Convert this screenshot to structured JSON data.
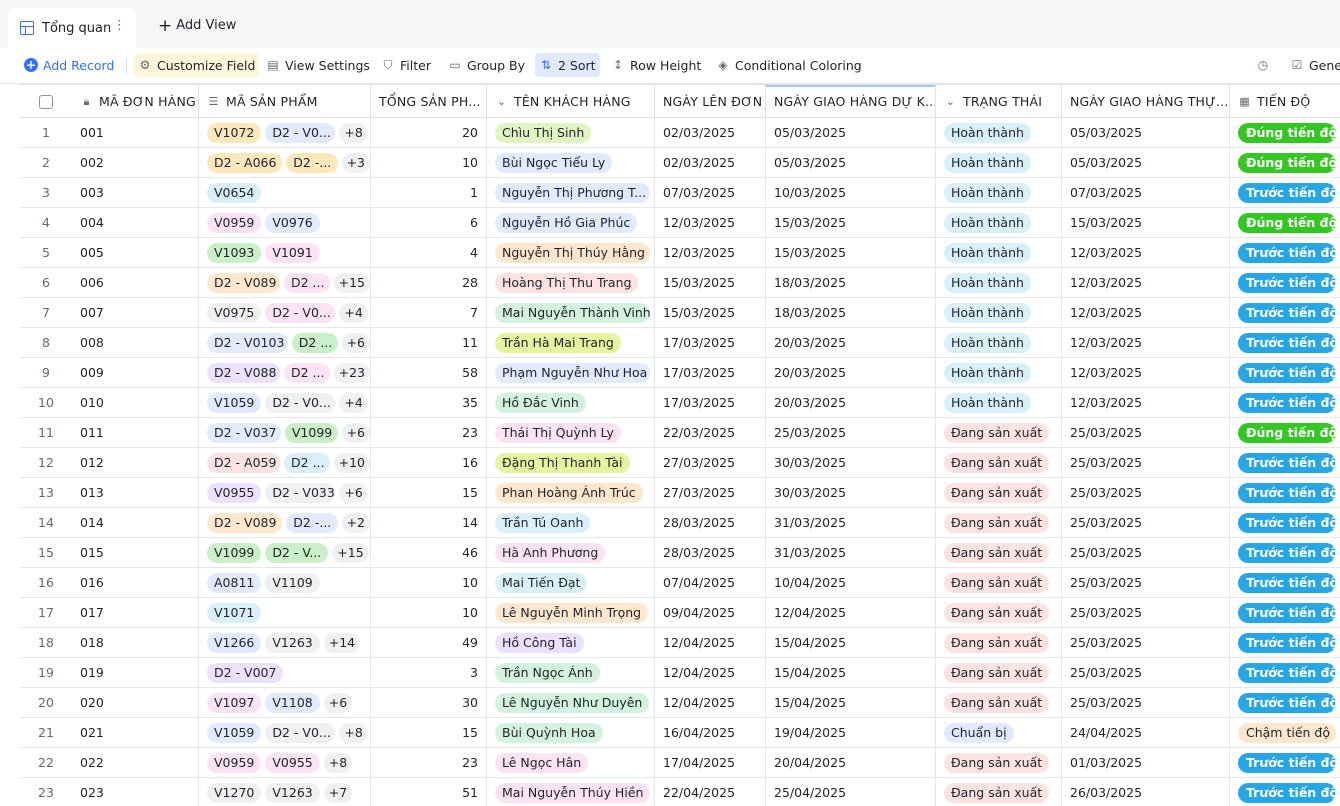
{
  "tabs": {
    "active_label": "Tổng quan",
    "add_view_label": "Add View"
  },
  "toolbar": {
    "add_record": "Add Record",
    "customize_field": "Customize Field",
    "view_settings": "View Settings",
    "filter": "Filter",
    "group_by": "Group By",
    "sort": "2 Sort",
    "row_height": "Row Height",
    "conditional_coloring": "Conditional Coloring",
    "generate": "Gener"
  },
  "colors": {
    "accent": "#3370ff",
    "status_done": "#d9f0fb",
    "status_producing": "#fde2e2",
    "status_prepare": "#e1eaff",
    "progress_on_time": "#34c724",
    "progress_ahead": "#27a6e5",
    "progress_late": "#fee7cd"
  },
  "columns": [
    "MÃ ĐƠN HÀNG",
    "MÃ SẢN PHẨM",
    "TỔNG SẢN PH...",
    "TÊN KHÁCH HÀNG",
    "NGÀY LÊN ĐƠN",
    "NGÀY GIAO HÀNG DỰ K...",
    "TRẠNG THÁI",
    "NGÀY GIAO HÀNG THỰ...",
    "TIẾN ĐỘ"
  ],
  "column_icons": [
    "lock-icon",
    "multi-select-icon",
    "",
    "single-select-icon",
    "",
    "",
    "single-select-icon",
    "",
    "formula-icon"
  ],
  "rows": [
    {
      "n": "1",
      "code": "001",
      "products": [
        "V1072",
        "D2 - V0..."
      ],
      "more": "+8",
      "total": "20",
      "customer": "Chìu Thị Sinh",
      "order_date": "02/03/2025",
      "expected": "05/03/2025",
      "status": "Hoàn thành",
      "actual": "05/03/2025",
      "progress": "Đúng tiến độ"
    },
    {
      "n": "2",
      "code": "002",
      "products": [
        "D2 - A066",
        "D2 -..."
      ],
      "more": "+3",
      "total": "10",
      "customer": "Bùi Ngọc Tiểu Ly",
      "order_date": "02/03/2025",
      "expected": "05/03/2025",
      "status": "Hoàn thành",
      "actual": "05/03/2025",
      "progress": "Đúng tiến độ"
    },
    {
      "n": "3",
      "code": "003",
      "products": [
        "V0654"
      ],
      "more": "",
      "total": "1",
      "customer": "Nguyễn Thị Phương T...",
      "order_date": "07/03/2025",
      "expected": "10/03/2025",
      "status": "Hoàn thành",
      "actual": "07/03/2025",
      "progress": "Trước tiến độ"
    },
    {
      "n": "4",
      "code": "004",
      "products": [
        "V0959",
        "V0976"
      ],
      "more": "",
      "total": "6",
      "customer": "Nguyễn Hồ Gia Phúc",
      "order_date": "12/03/2025",
      "expected": "15/03/2025",
      "status": "Hoàn thành",
      "actual": "15/03/2025",
      "progress": "Đúng tiến độ"
    },
    {
      "n": "5",
      "code": "005",
      "products": [
        "V1093",
        "V1091"
      ],
      "more": "",
      "total": "4",
      "customer": "Nguyễn Thị Thúy Hằng",
      "order_date": "12/03/2025",
      "expected": "15/03/2025",
      "status": "Hoàn thành",
      "actual": "12/03/2025",
      "progress": "Trước tiến độ"
    },
    {
      "n": "6",
      "code": "006",
      "products": [
        "D2 - V089",
        "D2 ..."
      ],
      "more": "+15",
      "total": "28",
      "customer": "Hoàng Thị Thu Trang",
      "order_date": "15/03/2025",
      "expected": "18/03/2025",
      "status": "Hoàn thành",
      "actual": "12/03/2025",
      "progress": "Trước tiến độ"
    },
    {
      "n": "7",
      "code": "007",
      "products": [
        "V0975",
        "D2 - V0..."
      ],
      "more": "+4",
      "total": "7",
      "customer": "Mai Nguyễn Thành Vinh",
      "order_date": "15/03/2025",
      "expected": "18/03/2025",
      "status": "Hoàn thành",
      "actual": "12/03/2025",
      "progress": "Trước tiến độ"
    },
    {
      "n": "8",
      "code": "008",
      "products": [
        "D2 - V0103",
        "D2 ..."
      ],
      "more": "+6",
      "total": "11",
      "customer": "Trần Hà Mai Trang",
      "order_date": "17/03/2025",
      "expected": "20/03/2025",
      "status": "Hoàn thành",
      "actual": "12/03/2025",
      "progress": "Trước tiến độ"
    },
    {
      "n": "9",
      "code": "009",
      "products": [
        "D2 - V088",
        "D2 ..."
      ],
      "more": "+23",
      "total": "58",
      "customer": "Phạm Nguyễn Như Hoa",
      "order_date": "17/03/2025",
      "expected": "20/03/2025",
      "status": "Hoàn thành",
      "actual": "12/03/2025",
      "progress": "Trước tiến độ"
    },
    {
      "n": "10",
      "code": "010",
      "products": [
        "V1059",
        "D2 - V0..."
      ],
      "more": "+4",
      "total": "35",
      "customer": "Hồ Đắc Vinh",
      "order_date": "17/03/2025",
      "expected": "20/03/2025",
      "status": "Hoàn thành",
      "actual": "12/03/2025",
      "progress": "Trước tiến độ"
    },
    {
      "n": "11",
      "code": "011",
      "products": [
        "D2 - V037",
        "V1099"
      ],
      "more": "+6",
      "total": "23",
      "customer": "Thái Thị Quỳnh Ly",
      "order_date": "22/03/2025",
      "expected": "25/03/2025",
      "status": "Đang sản xuất",
      "actual": "25/03/2025",
      "progress": "Đúng tiến độ"
    },
    {
      "n": "12",
      "code": "012",
      "products": [
        "D2 - A059",
        "D2 ..."
      ],
      "more": "+10",
      "total": "16",
      "customer": "Đặng Thị Thanh Tài",
      "order_date": "27/03/2025",
      "expected": "30/03/2025",
      "status": "Đang sản xuất",
      "actual": "25/03/2025",
      "progress": "Trước tiến độ"
    },
    {
      "n": "13",
      "code": "013",
      "products": [
        "V0955",
        "D2 - V033"
      ],
      "more": "+6",
      "total": "15",
      "customer": "Phan Hoàng Ánh Trúc",
      "order_date": "27/03/2025",
      "expected": "30/03/2025",
      "status": "Đang sản xuất",
      "actual": "25/03/2025",
      "progress": "Trước tiến độ"
    },
    {
      "n": "14",
      "code": "014",
      "products": [
        "D2 - V089",
        "D2 -..."
      ],
      "more": "+2",
      "total": "14",
      "customer": "Trần Tú Oanh",
      "order_date": "28/03/2025",
      "expected": "31/03/2025",
      "status": "Đang sản xuất",
      "actual": "25/03/2025",
      "progress": "Trước tiến độ"
    },
    {
      "n": "15",
      "code": "015",
      "products": [
        "V1099",
        "D2 - V..."
      ],
      "more": "+15",
      "total": "46",
      "customer": "Hà Anh Phương",
      "order_date": "28/03/2025",
      "expected": "31/03/2025",
      "status": "Đang sản xuất",
      "actual": "25/03/2025",
      "progress": "Trước tiến độ"
    },
    {
      "n": "16",
      "code": "016",
      "products": [
        "A0811",
        "V1109"
      ],
      "more": "",
      "total": "10",
      "customer": "Mai Tiến Đạt",
      "order_date": "07/04/2025",
      "expected": "10/04/2025",
      "status": "Đang sản xuất",
      "actual": "25/03/2025",
      "progress": "Trước tiến độ"
    },
    {
      "n": "17",
      "code": "017",
      "products": [
        "V1071"
      ],
      "more": "",
      "total": "10",
      "customer": "Lê Nguyễn Minh Trọng",
      "order_date": "09/04/2025",
      "expected": "12/04/2025",
      "status": "Đang sản xuất",
      "actual": "25/03/2025",
      "progress": "Trước tiến độ"
    },
    {
      "n": "18",
      "code": "018",
      "products": [
        "V1266",
        "V1263"
      ],
      "more": "+14",
      "total": "49",
      "customer": "Hồ Công Tài",
      "order_date": "12/04/2025",
      "expected": "15/04/2025",
      "status": "Đang sản xuất",
      "actual": "25/03/2025",
      "progress": "Trước tiến độ"
    },
    {
      "n": "19",
      "code": "019",
      "products": [
        "D2 - V007"
      ],
      "more": "",
      "total": "3",
      "customer": "Trần Ngọc Ánh",
      "order_date": "12/04/2025",
      "expected": "15/04/2025",
      "status": "Đang sản xuất",
      "actual": "25/03/2025",
      "progress": "Trước tiến độ"
    },
    {
      "n": "20",
      "code": "020",
      "products": [
        "V1097",
        "V1108"
      ],
      "more": "+6",
      "total": "30",
      "customer": "Lê Nguyễn Như Duyên",
      "order_date": "12/04/2025",
      "expected": "15/04/2025",
      "status": "Đang sản xuất",
      "actual": "25/03/2025",
      "progress": "Trước tiến độ"
    },
    {
      "n": "21",
      "code": "021",
      "products": [
        "V1059",
        "D2 - V0..."
      ],
      "more": "+8",
      "total": "15",
      "customer": "Bùi Quỳnh Hoa",
      "order_date": "16/04/2025",
      "expected": "19/04/2025",
      "status": "Chuẩn bị",
      "actual": "24/04/2025",
      "progress": "Chậm tiến độ"
    },
    {
      "n": "22",
      "code": "022",
      "products": [
        "V0959",
        "V0955"
      ],
      "more": "+8",
      "total": "23",
      "customer": "Lê Ngọc Hân",
      "order_date": "17/04/2025",
      "expected": "20/04/2025",
      "status": "Đang sản xuất",
      "actual": "01/03/2025",
      "progress": "Trước tiến độ"
    },
    {
      "n": "23",
      "code": "023",
      "products": [
        "V1270",
        "V1263"
      ],
      "more": "+7",
      "total": "51",
      "customer": "Mai Nguyễn Thúy Hiền",
      "order_date": "22/04/2025",
      "expected": "25/04/2025",
      "status": "Đang sản xuất",
      "actual": "26/03/2025",
      "progress": "Trước tiến độ"
    }
  ]
}
